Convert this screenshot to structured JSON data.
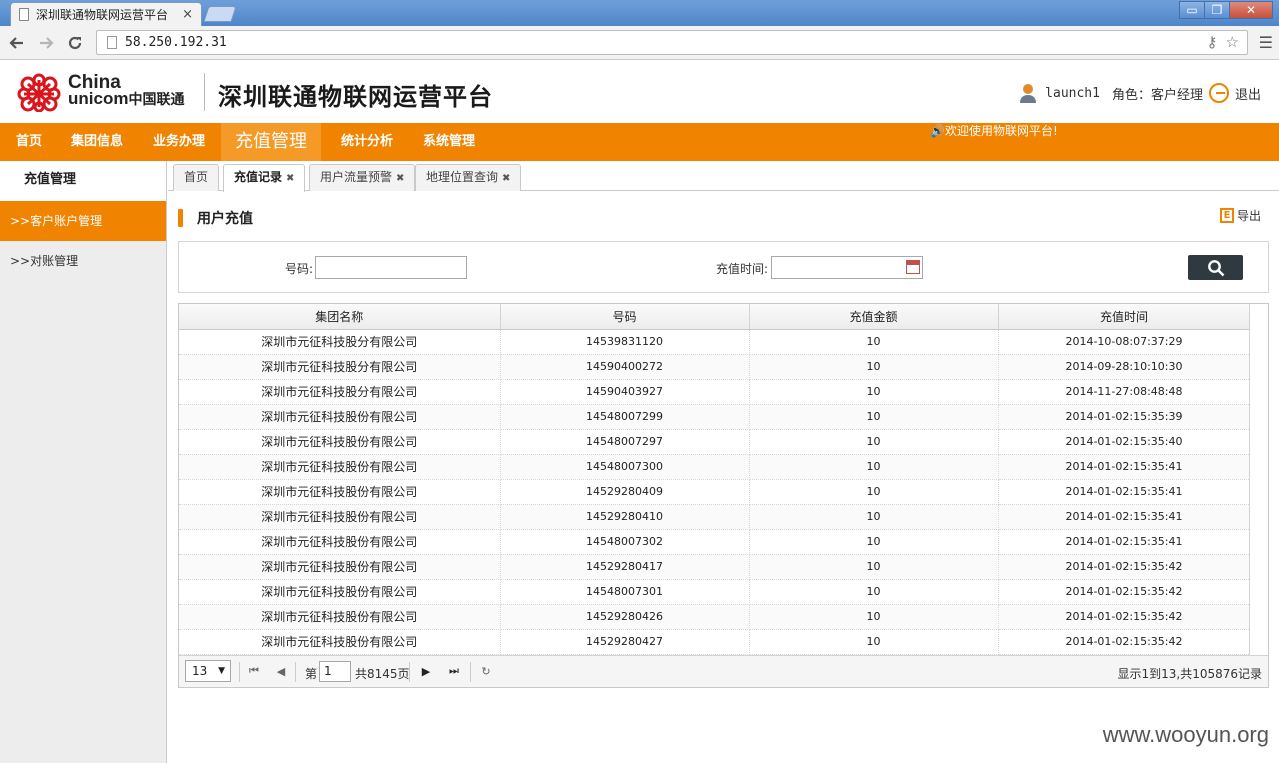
{
  "browser": {
    "tab_title": "深圳联通物联网运营平台",
    "tab_close": "×",
    "url": "58.250.192.31",
    "window_buttons": {
      "minimize": "▭",
      "restore": "❐",
      "close": "✕"
    },
    "icons": [
      "back-icon",
      "forward-icon",
      "reload-icon",
      "key-icon",
      "star-icon",
      "menu-icon"
    ]
  },
  "header": {
    "logo_line1": "China",
    "logo_line2": "unicom",
    "logo_cn": "中国联通",
    "platform_title": "深圳联通物联网运营平台",
    "username": "launch1",
    "role": "角色：客户经理",
    "logout": "退出",
    "brand_color": "#f08300"
  },
  "nav": {
    "items": [
      "首页",
      "集团信息",
      "业务办理",
      "充值管理",
      "统计分析",
      "系统管理"
    ],
    "active": "充值管理",
    "marquee": "🔊欢迎使用物联网平台!"
  },
  "sidebar": {
    "title": "充值管理",
    "items": [
      {
        "label": ">>客户账户管理",
        "active": true
      },
      {
        "label": ">>对账管理",
        "active": false
      }
    ]
  },
  "tabs": [
    {
      "label": "首页",
      "closable": false
    },
    {
      "label": "充值记录",
      "closable": true,
      "active": true
    },
    {
      "label": "用户流量预警",
      "closable": true
    },
    {
      "label": "地理位置查询",
      "closable": true
    }
  ],
  "page": {
    "title": "用户充值",
    "export_icon": "E",
    "export_label": "导出",
    "search": {
      "number_label": "号码:",
      "number_value": "",
      "time_label": "充值时间:",
      "time_value": ""
    }
  },
  "table": {
    "columns": [
      "集团名称",
      "号码",
      "充值金额",
      "充值时间"
    ],
    "rows": [
      [
        "深圳市元征科技股分有限公司",
        "14539831120",
        "10",
        "2014-10-08:07:37:29"
      ],
      [
        "深圳市元征科技股分有限公司",
        "14590400272",
        "10",
        "2014-09-28:10:10:30"
      ],
      [
        "深圳市元征科技股分有限公司",
        "14590403927",
        "10",
        "2014-11-27:08:48:48"
      ],
      [
        "深圳市元征科技股份有限公司",
        "14548007299",
        "10",
        "2014-01-02:15:35:39"
      ],
      [
        "深圳市元征科技股份有限公司",
        "14548007297",
        "10",
        "2014-01-02:15:35:40"
      ],
      [
        "深圳市元征科技股份有限公司",
        "14548007300",
        "10",
        "2014-01-02:15:35:41"
      ],
      [
        "深圳市元征科技股份有限公司",
        "14529280409",
        "10",
        "2014-01-02:15:35:41"
      ],
      [
        "深圳市元征科技股份有限公司",
        "14529280410",
        "10",
        "2014-01-02:15:35:41"
      ],
      [
        "深圳市元征科技股份有限公司",
        "14548007302",
        "10",
        "2014-01-02:15:35:41"
      ],
      [
        "深圳市元征科技股份有限公司",
        "14529280417",
        "10",
        "2014-01-02:15:35:42"
      ],
      [
        "深圳市元征科技股份有限公司",
        "14548007301",
        "10",
        "2014-01-02:15:35:42"
      ],
      [
        "深圳市元征科技股份有限公司",
        "14529280426",
        "10",
        "2014-01-02:15:35:42"
      ],
      [
        "深圳市元征科技股份有限公司",
        "14529280427",
        "10",
        "2014-01-02:15:35:42"
      ]
    ]
  },
  "pager": {
    "page_size": "13",
    "page_label": "第",
    "current_page": "1",
    "total_pages_label": "共8145页",
    "info": "显示1到13,共105876记录"
  },
  "watermark": "www.wooyun.org"
}
